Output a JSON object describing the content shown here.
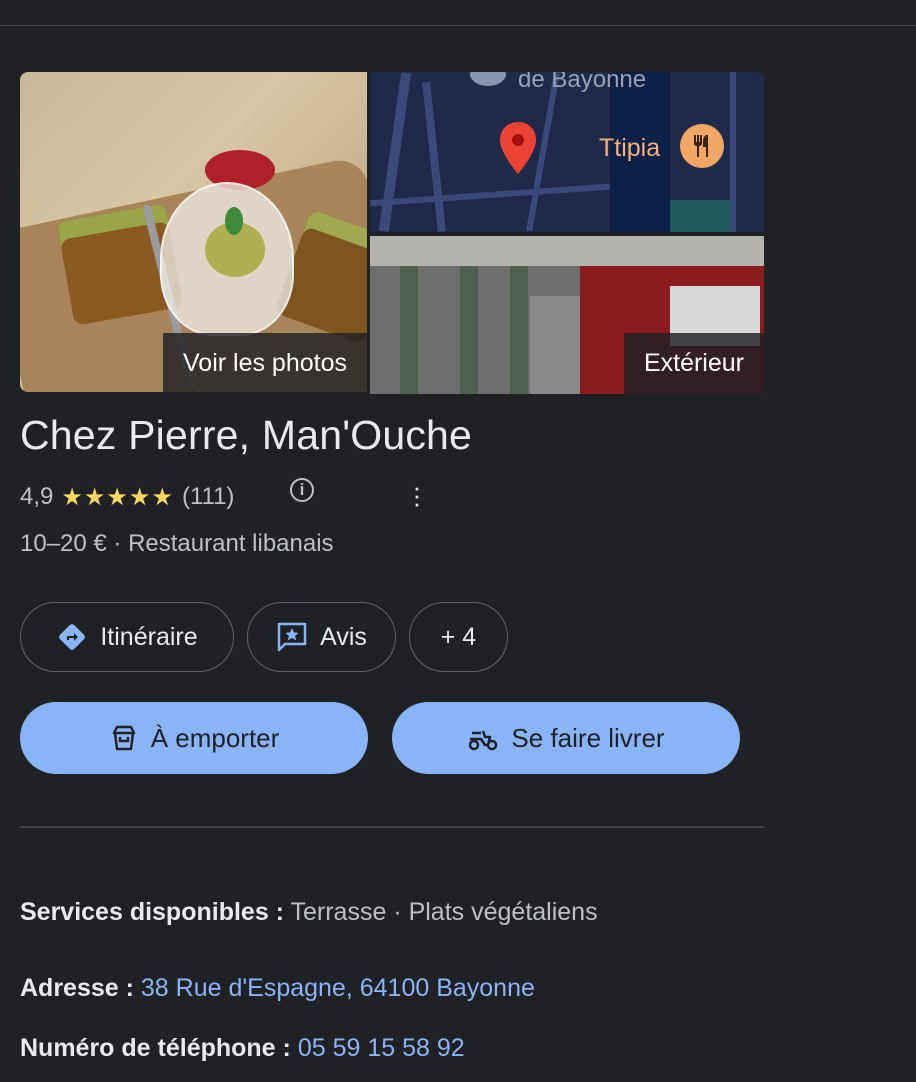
{
  "photos": {
    "main_label": "Voir les photos",
    "exterior_label": "Extérieur",
    "map": {
      "street_text": "de Bayonne",
      "poi_name": "Ttipia"
    }
  },
  "place": {
    "name": "Chez Pierre, Man'Ouche",
    "rating": "4,9",
    "stars": "★★★★★",
    "review_count": "(111)",
    "price_category": "10–20 € · Restaurant libanais"
  },
  "chips": {
    "directions": "Itinéraire",
    "reviews": "Avis",
    "more": "+ 4"
  },
  "actions": {
    "takeaway": "À emporter",
    "delivery": "Se faire livrer"
  },
  "details": {
    "services_label": "Services disponibles :",
    "services_value": "Terrasse · Plats végétaliens",
    "address_label": "Adresse :",
    "address_value": "38 Rue d'Espagne, 64100 Bayonne",
    "phone_label": "Numéro de téléphone :",
    "phone_value": "05 59 15 58 92"
  },
  "colors": {
    "background": "#202124",
    "accent": "#8ab4f8",
    "star": "#fdd663"
  }
}
